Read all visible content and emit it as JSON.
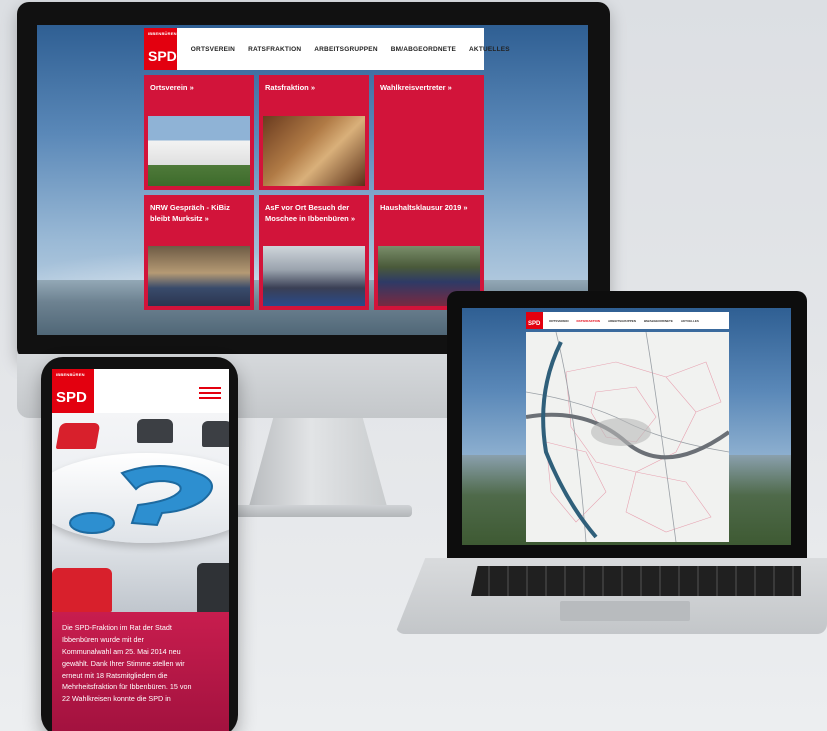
{
  "imac": {
    "nav": {
      "logo_text": "SPD",
      "logo_small": "IBBENBÜREN",
      "items": [
        "ORTSVEREIN",
        "RATSFRAKTION",
        "ARBEITSGRUPPEN",
        "BM/ABGEORDNETE",
        "AKTUELLES"
      ]
    },
    "tiles": [
      {
        "title": "Ortsverein  »",
        "photo": "house"
      },
      {
        "title": "Ratsfraktion  »",
        "photo": "council-chamber"
      },
      {
        "title": "Wahlkreisvertreter  »",
        "photo": ""
      },
      {
        "title": "NRW Gespräch - KiBiz bleibt Murksitz  »",
        "photo": "meeting"
      },
      {
        "title": "AsF vor Ort Besuch der Moschee in Ibbenbüren  »",
        "photo": "mosque"
      },
      {
        "title": "Haushaltsklausur 2019  »",
        "photo": "group"
      }
    ]
  },
  "laptop": {
    "nav": {
      "logo_text": "SPD",
      "items": [
        "ORTSVEREIN",
        "RATSFRAKTION",
        "ARBEITSGRUPPEN",
        "BM/ABGEORDNETE",
        "AKTUELLES"
      ],
      "active_index": 1
    }
  },
  "phone": {
    "logo_text": "SPD",
    "logo_small": "IBBENBÜREN",
    "text_lines": [
      "Die SPD-Fraktion im Rat der Stadt",
      "Ibbenbüren wurde mit der",
      "Kommunalwahl am 25. Mai 2014 neu",
      "gewählt. Dank Ihrer Stimme stellen wir",
      "erneut mit 18 Ratsmitgliedern die",
      "Mehrheitsfraktion für Ibbenbüren. 15 von",
      "22 Wahlkreisen konnte die SPD in"
    ]
  },
  "colors": {
    "spd_red": "#e3000f",
    "tile_red": "#d2143a",
    "phone_text_bg": "#c81d4e"
  }
}
